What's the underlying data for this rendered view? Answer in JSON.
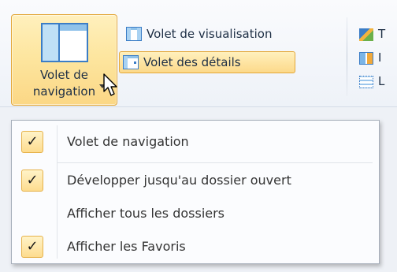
{
  "ribbon": {
    "nav_pane": {
      "line1": "Volet de",
      "line2": "navigation",
      "icon": "navigation-pane-icon"
    },
    "preview_pane": {
      "label": "Volet de visualisation",
      "icon": "preview-pane-icon"
    },
    "details_pane": {
      "label": "Volet des détails",
      "icon": "details-pane-icon"
    },
    "right_letters": [
      "T",
      "I",
      "L"
    ]
  },
  "menu": {
    "items": [
      {
        "label": "Volet de navigation",
        "checked": true
      },
      {
        "label": "Développer jusqu'au dossier ouvert",
        "checked": true
      },
      {
        "label": "Afficher tous les dossiers",
        "checked": false
      },
      {
        "label": "Afficher les Favoris",
        "checked": true
      }
    ],
    "check_glyph": "✓"
  },
  "colors": {
    "highlight_border": "#e3a739",
    "highlight_fill": "#fde6a0",
    "icon_blue": "#3b7dc6"
  }
}
